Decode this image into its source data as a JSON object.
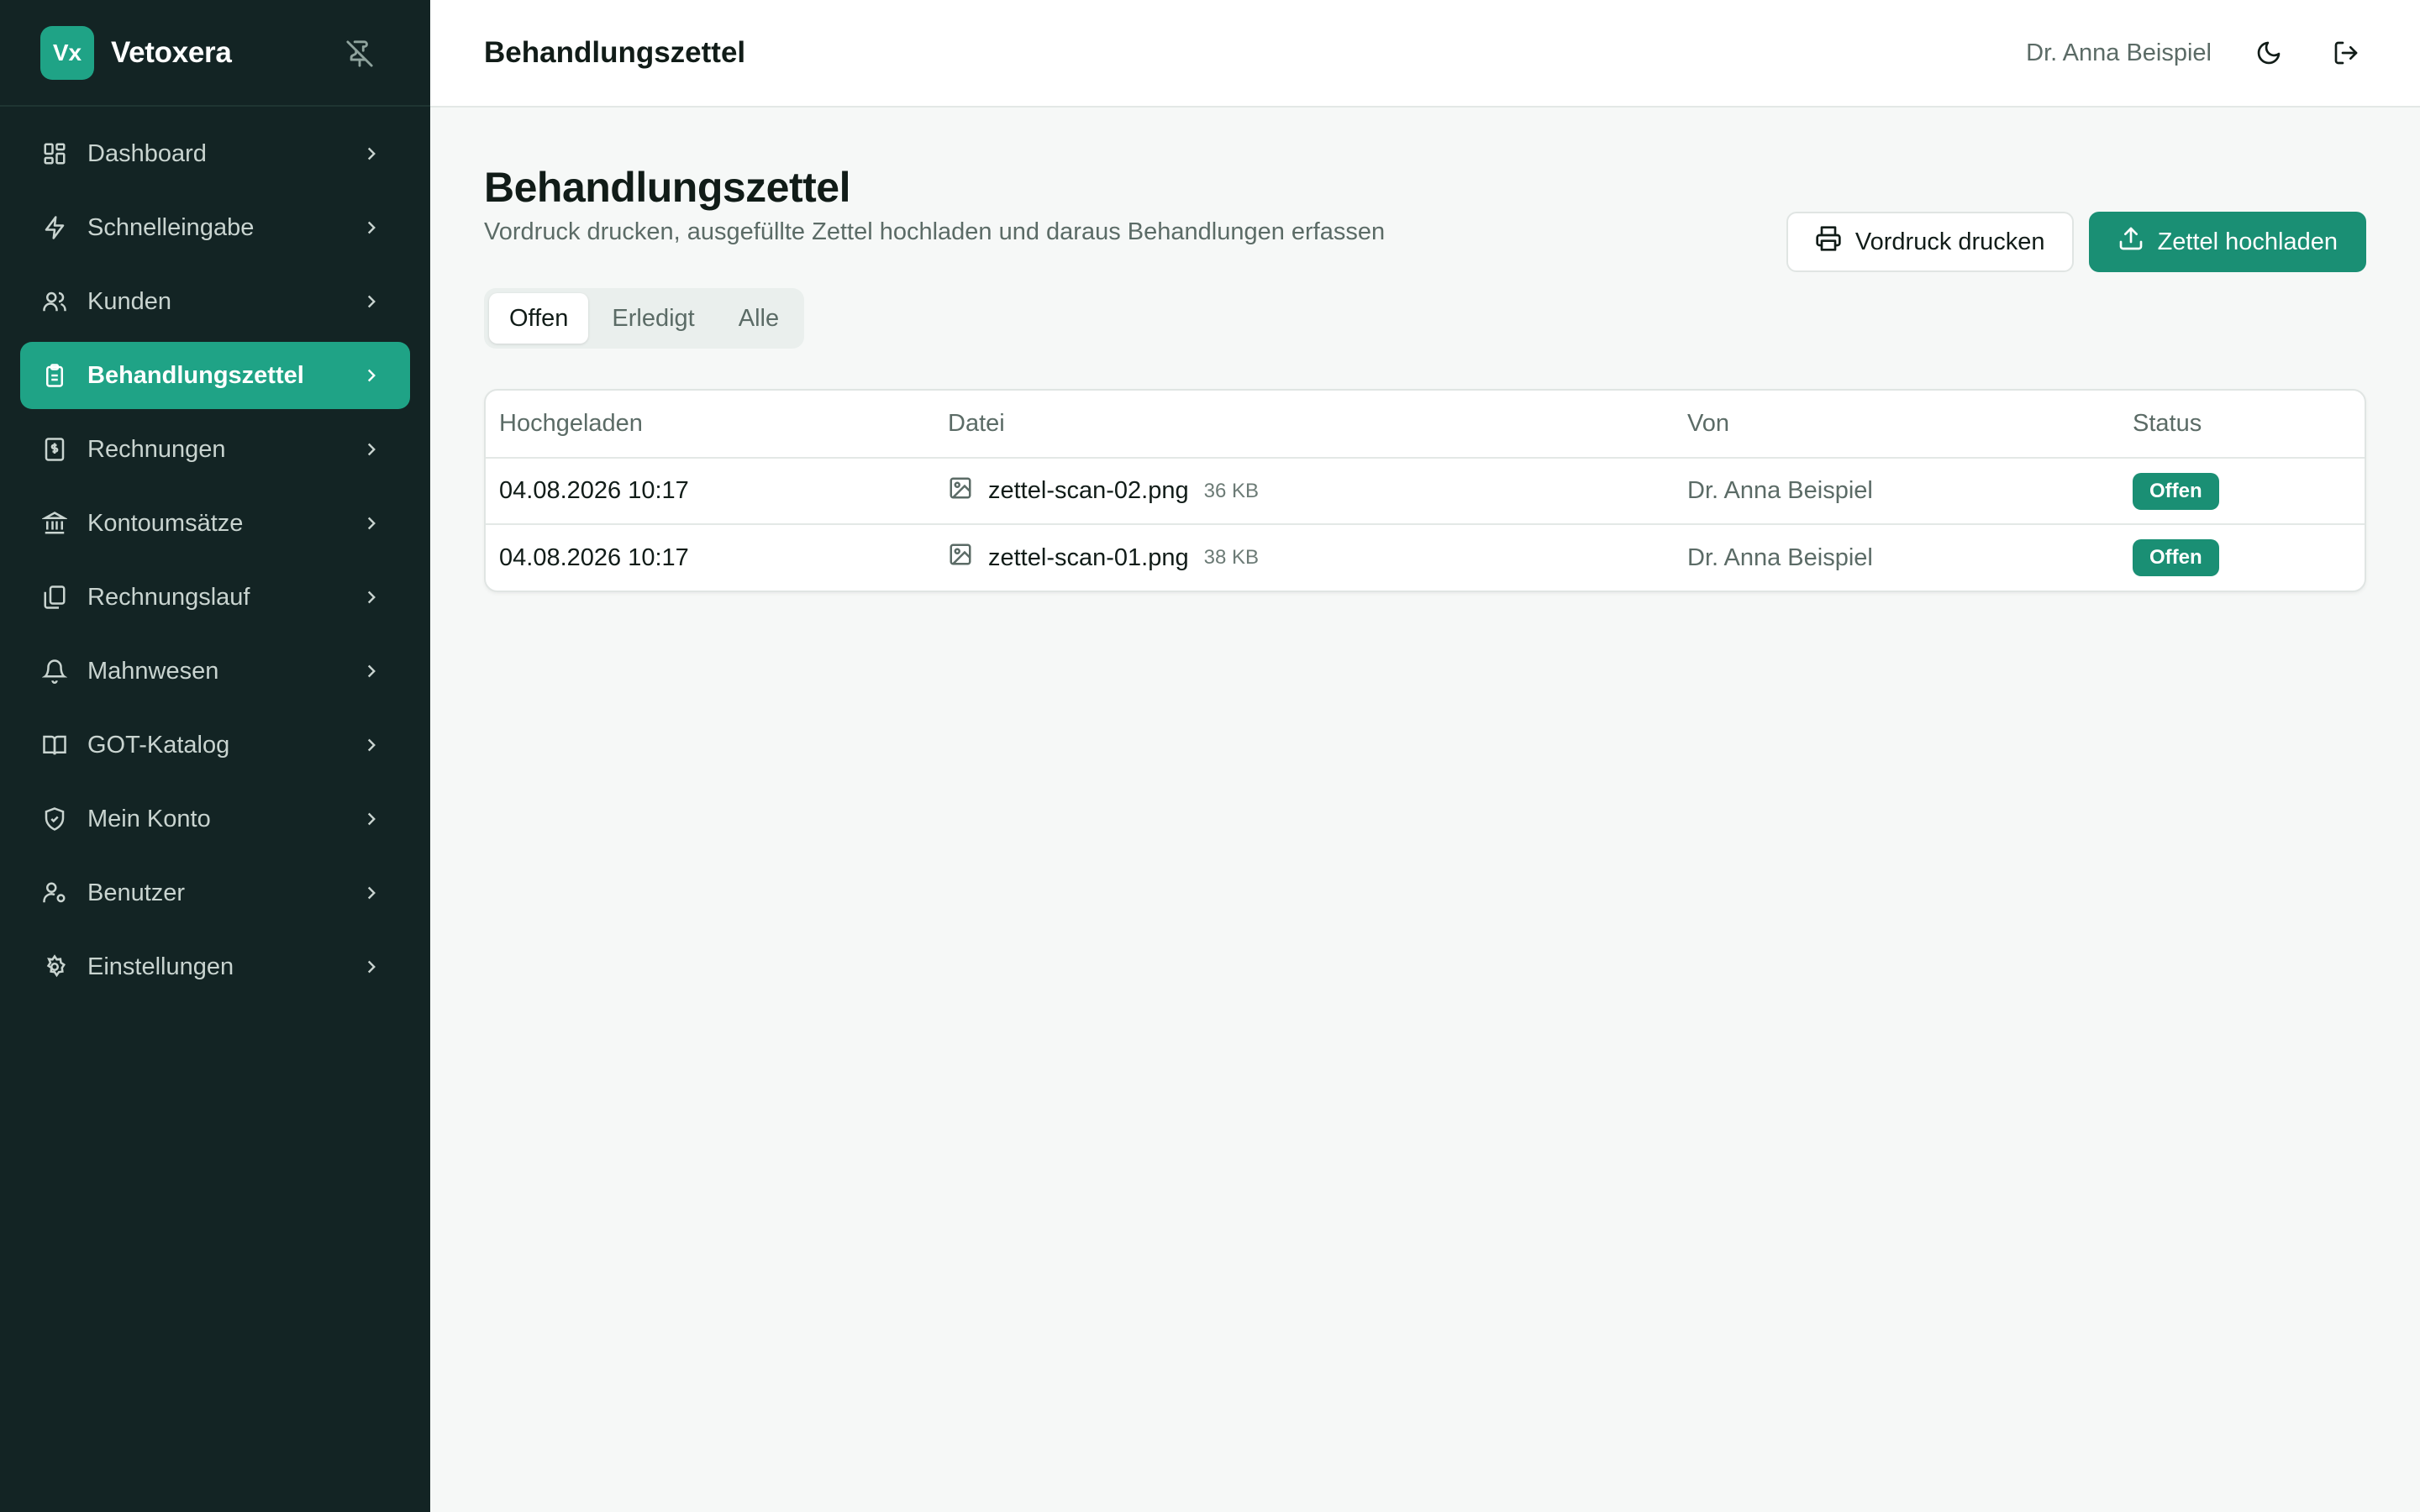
{
  "brand": {
    "logo_text": "Vx",
    "name": "Vetoxera"
  },
  "sidebar": {
    "items": [
      {
        "label": "Dashboard",
        "icon": "dashboard-icon"
      },
      {
        "label": "Schnelleingabe",
        "icon": "lightning-icon"
      },
      {
        "label": "Kunden",
        "icon": "users-icon"
      },
      {
        "label": "Behandlungszettel",
        "icon": "clipboard-icon",
        "active": true
      },
      {
        "label": "Rechnungen",
        "icon": "receipt-icon"
      },
      {
        "label": "Kontoumsätze",
        "icon": "bank-icon"
      },
      {
        "label": "Rechnungslauf",
        "icon": "files-icon"
      },
      {
        "label": "Mahnwesen",
        "icon": "bell-icon"
      },
      {
        "label": "GOT-Katalog",
        "icon": "book-icon"
      },
      {
        "label": "Mein Konto",
        "icon": "shield-icon"
      },
      {
        "label": "Benutzer",
        "icon": "user-cog-icon"
      },
      {
        "label": "Einstellungen",
        "icon": "gear-icon"
      }
    ]
  },
  "header": {
    "title": "Behandlungszettel",
    "user_name": "Dr. Anna Beispiel"
  },
  "page": {
    "title": "Behandlungszettel",
    "subtitle": "Vordruck drucken, ausgefüllte Zettel hochladen und daraus Behandlungen erfassen",
    "print_label": "Vordruck drucken",
    "upload_label": "Zettel hochladen"
  },
  "tabs": [
    "Offen",
    "Erledigt",
    "Alle"
  ],
  "table": {
    "headers": [
      "Hochgeladen",
      "Datei",
      "Von",
      "Status"
    ],
    "rows": [
      {
        "uploaded": "04.08.2026 10:17",
        "file": "zettel-scan-02.png",
        "size": "36 KB",
        "by": "Dr. Anna Beispiel",
        "status": "Offen"
      },
      {
        "uploaded": "04.08.2026 10:17",
        "file": "zettel-scan-01.png",
        "size": "38 KB",
        "by": "Dr. Anna Beispiel",
        "status": "Offen"
      }
    ]
  },
  "colors": {
    "sidebar_bg": "#132424",
    "accent": "#1fa386",
    "primary": "#1a8f74"
  }
}
